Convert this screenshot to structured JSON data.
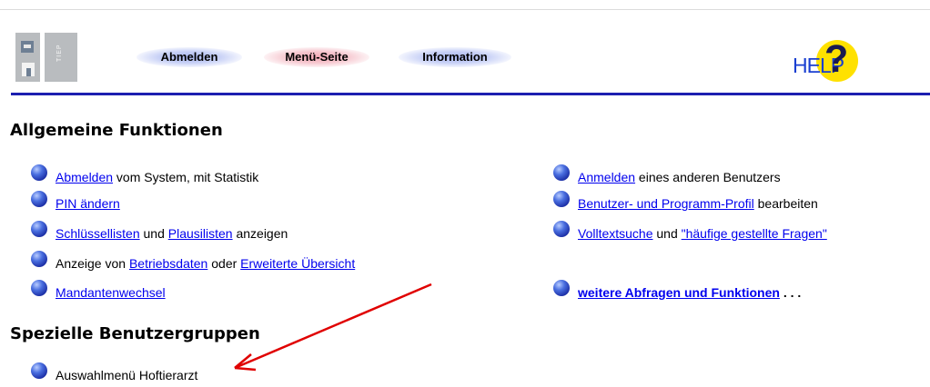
{
  "header": {
    "logo_text": "TIEP",
    "nav": [
      {
        "label": "Abmelden",
        "color": "#c7d0f6"
      },
      {
        "label": "Menü-Seite",
        "color": "#f6c7cf"
      },
      {
        "label": "Information",
        "color": "#c7d0f6"
      }
    ],
    "help": {
      "word": "HELP",
      "mark": "?"
    }
  },
  "sections": {
    "general": {
      "title": "Allgemeine Funktionen",
      "left": [
        {
          "link": "Abmelden",
          "text": " vom System, mit Statistik"
        },
        {
          "link": "PIN ändern"
        },
        {
          "link": "Schlüssellisten",
          "mid": " und ",
          "link2": "Plausilisten",
          "text": " anzeigen"
        },
        {
          "prefix": "Anzeige von ",
          "link": "Betriebsdaten",
          "mid": " oder ",
          "link2": "Erweiterte Übersicht"
        },
        {
          "link": "Mandantenwechsel"
        }
      ],
      "right": [
        {
          "link": "Anmelden",
          "text": " eines anderen Benutzers"
        },
        {
          "link": "Benutzer- und Programm-Profil",
          "text": " bearbeiten"
        },
        {
          "link": "Volltextsuche",
          "mid": " und ",
          "link2": "\"häufige gestellte Fragen\""
        },
        {
          "link": "weitere Abfragen und Funktionen",
          "text": " . . ."
        }
      ]
    },
    "special": {
      "title": "Spezielle Benutzergruppen",
      "items": [
        {
          "text": "Auswahlmenü Hoftierarzt"
        }
      ]
    }
  },
  "colors": {
    "rule": "#1c1fb0",
    "link": "#0000ee",
    "annotation_arrow": "#e00000"
  }
}
